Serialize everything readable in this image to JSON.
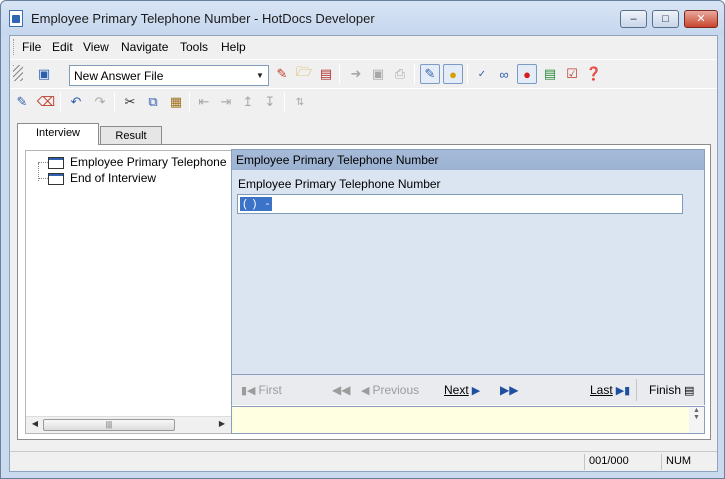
{
  "window": {
    "title": "Employee Primary Telephone Number - HotDocs Developer",
    "minimize": "–",
    "maximize": "□",
    "close": "✕"
  },
  "menu": [
    "File",
    "Edit",
    "View",
    "Navigate",
    "Tools",
    "Help"
  ],
  "toolbar": {
    "answer_file": "New Answer File"
  },
  "tabs": {
    "interview": "Interview",
    "result": "Result"
  },
  "tree": {
    "items": [
      "Employee Primary Telephone",
      "End of Interview"
    ]
  },
  "dialog": {
    "header": "Employee Primary Telephone Number",
    "prompt": "Employee Primary Telephone Number",
    "field_value": "(  )   -"
  },
  "navigation": {
    "first": "First",
    "previous": "Previous",
    "next": "Next",
    "last": "Last",
    "finish": "Finish"
  },
  "status": {
    "pages": "001/000",
    "mode": "NUM"
  }
}
